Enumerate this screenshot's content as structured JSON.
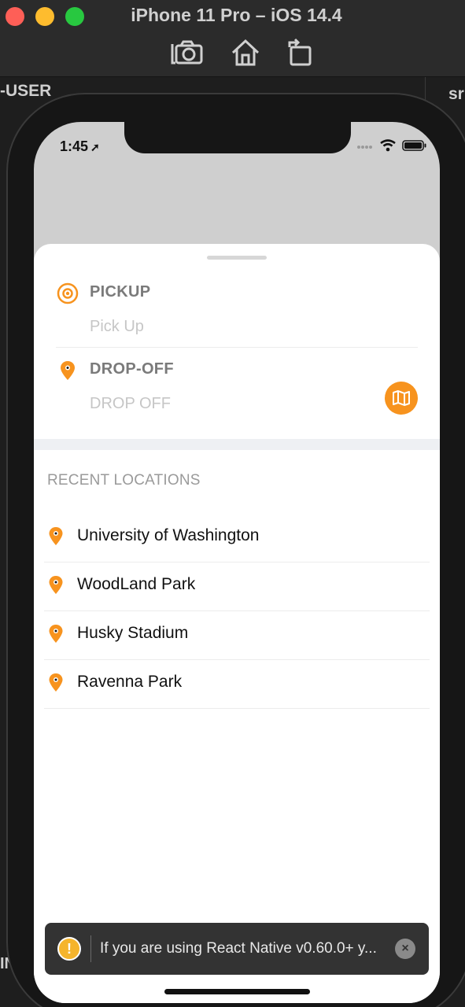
{
  "simulator": {
    "title": "iPhone 11 Pro – iOS 14.4",
    "left_pane_label": "-USER",
    "right_pane_label": "sr",
    "bottom_pane_label": "IN"
  },
  "status_bar": {
    "time": "1:45",
    "location_arrow": "➚"
  },
  "route": {
    "pickup_label": "PICKUP",
    "pickup_placeholder": "Pick Up",
    "dropoff_label": "DROP-OFF",
    "dropoff_placeholder": "DROP OFF"
  },
  "recent": {
    "title": "RECENT LOCATIONS",
    "items": [
      {
        "name": "University of Washington"
      },
      {
        "name": "WoodLand Park"
      },
      {
        "name": "Husky Stadium"
      },
      {
        "name": "Ravenna Park"
      }
    ]
  },
  "toast": {
    "icon_text": "!",
    "message": "If you are using React Native v0.60.0+ y...",
    "close_text": "×"
  },
  "colors": {
    "accent": "#f7931e",
    "sheet_background": "#ffffff",
    "backdrop": "#cfcfcf"
  }
}
